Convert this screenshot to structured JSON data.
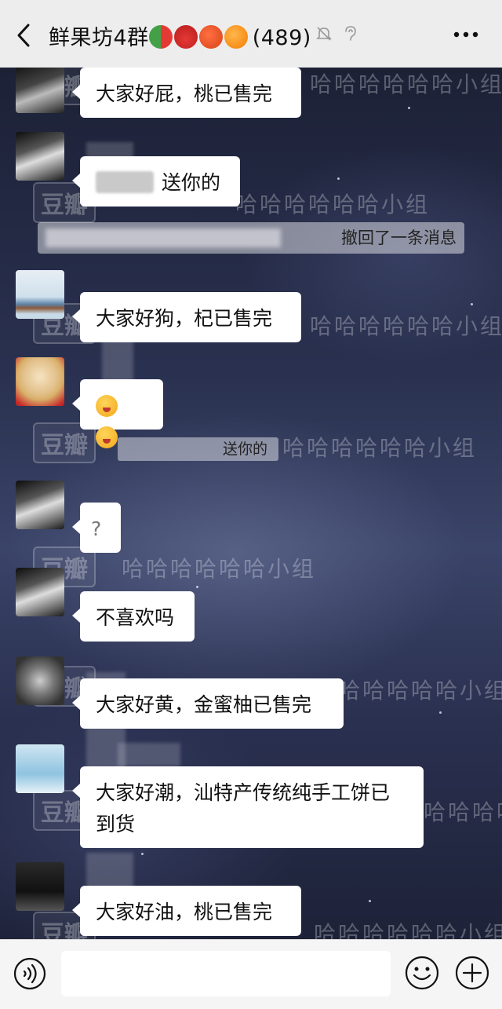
{
  "header": {
    "title": "鲜果坊4群",
    "member_count": "(489)",
    "icons": [
      "back-icon",
      "watermelon-emoji",
      "strawberry-emoji",
      "tomato-emoji",
      "orange-emoji",
      "mute-icon",
      "earpiece-icon",
      "more-icon"
    ]
  },
  "watermarks": {
    "haha": "哈哈哈哈哈哈小组",
    "douban": "豆瓣"
  },
  "messages": [
    {
      "text": "大家好屁，桃已售完"
    },
    {
      "text": "送你的"
    },
    {
      "text": "大家好狗，杞已售完"
    },
    {
      "text": "大家好黄，金蜜柚已售完"
    },
    {
      "text": "大家好潮，汕特产传统纯手工饼已到货"
    },
    {
      "text": "大家好油，桃已售完"
    }
  ],
  "system_notice": "撤回了一条消息",
  "quote_chip": "送你的",
  "question_mark": "?",
  "dislike_text": "不喜欢吗",
  "bottombar": {
    "icons": [
      "voice-icon",
      "emoji-icon",
      "plus-icon"
    ]
  }
}
